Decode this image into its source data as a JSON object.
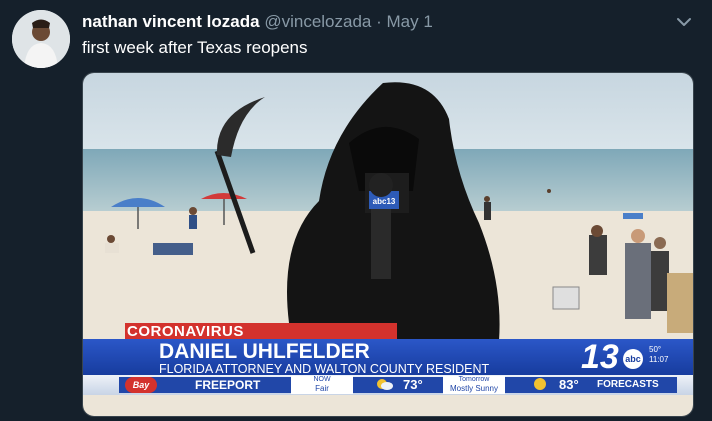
{
  "tweet": {
    "author_name": "nathan vincent lozada",
    "handle": "@vincelozada",
    "separator": "·",
    "date": "May 1",
    "text": "first week after Texas reopens",
    "menu_icon": "chevron-down-icon",
    "avatar": "user-avatar"
  },
  "broadcast": {
    "category": "CORONAVIRUS",
    "person_name": "DANIEL UHLFELDER",
    "person_title": "FLORIDA ATTORNEY AND WALTON COUNTY RESIDENT",
    "station_number": "13",
    "network": "abc",
    "corner_temp": "50°",
    "corner_time": "11:07",
    "ticker_logo": "Bay",
    "city": "FREEPORT",
    "now_label": "NOW",
    "now_condition": "Fair",
    "now_temp": "73°",
    "tomorrow_label": "Tomorrow",
    "tomorrow_condition": "Mostly Sunny",
    "tomorrow_temp": "83°",
    "forecasts_label": "FORECASTS",
    "mic_label": "abc13"
  },
  "colors": {
    "background": "#15202b",
    "secondary_text": "#8899a6",
    "lower_third_blue": "#2147a8",
    "category_red": "#d3322d"
  }
}
